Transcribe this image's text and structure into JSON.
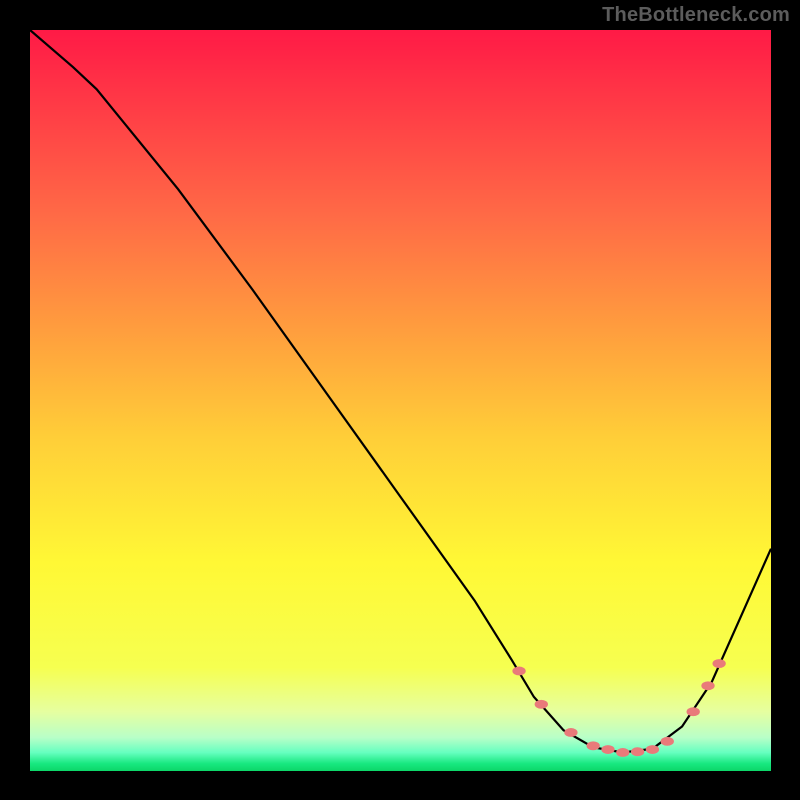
{
  "watermark": "TheBottleneck.com",
  "gradient_stops": [
    {
      "offset": 0.0,
      "color": "#ff1a46"
    },
    {
      "offset": 0.1,
      "color": "#ff3a46"
    },
    {
      "offset": 0.25,
      "color": "#ff6a46"
    },
    {
      "offset": 0.4,
      "color": "#ff9c3e"
    },
    {
      "offset": 0.55,
      "color": "#ffce38"
    },
    {
      "offset": 0.72,
      "color": "#fff835"
    },
    {
      "offset": 0.86,
      "color": "#f6ff50"
    },
    {
      "offset": 0.92,
      "color": "#e6ffa0"
    },
    {
      "offset": 0.955,
      "color": "#b8ffc8"
    },
    {
      "offset": 0.975,
      "color": "#66ffc0"
    },
    {
      "offset": 0.99,
      "color": "#18e880"
    },
    {
      "offset": 1.0,
      "color": "#0cd668"
    }
  ],
  "marker_color": "#e97a7a",
  "chart_data": {
    "type": "line",
    "title": "",
    "xlabel": "",
    "ylabel": "",
    "xlim": [
      0,
      100
    ],
    "ylim": [
      0,
      100
    ],
    "series": [
      {
        "name": "curve",
        "x": [
          0,
          5.8,
          9,
          20,
          30,
          40,
          50,
          60,
          65,
          68,
          72,
          76,
          80,
          84,
          88,
          92,
          96,
          100
        ],
        "y": [
          100,
          95,
          92,
          78.5,
          65,
          51,
          37,
          23,
          15,
          10,
          5.5,
          3.2,
          2.5,
          3.0,
          6,
          12,
          21,
          30
        ]
      }
    ],
    "markers": {
      "name": "highlight",
      "x": [
        66,
        69,
        73,
        76,
        78,
        80,
        82,
        84,
        86,
        89.5,
        91.5,
        93
      ],
      "y": [
        13.5,
        9.0,
        5.2,
        3.4,
        2.9,
        2.5,
        2.6,
        2.9,
        4.0,
        8.0,
        11.5,
        14.5
      ]
    },
    "marker_rx": 0.9,
    "marker_ry": 0.6
  }
}
